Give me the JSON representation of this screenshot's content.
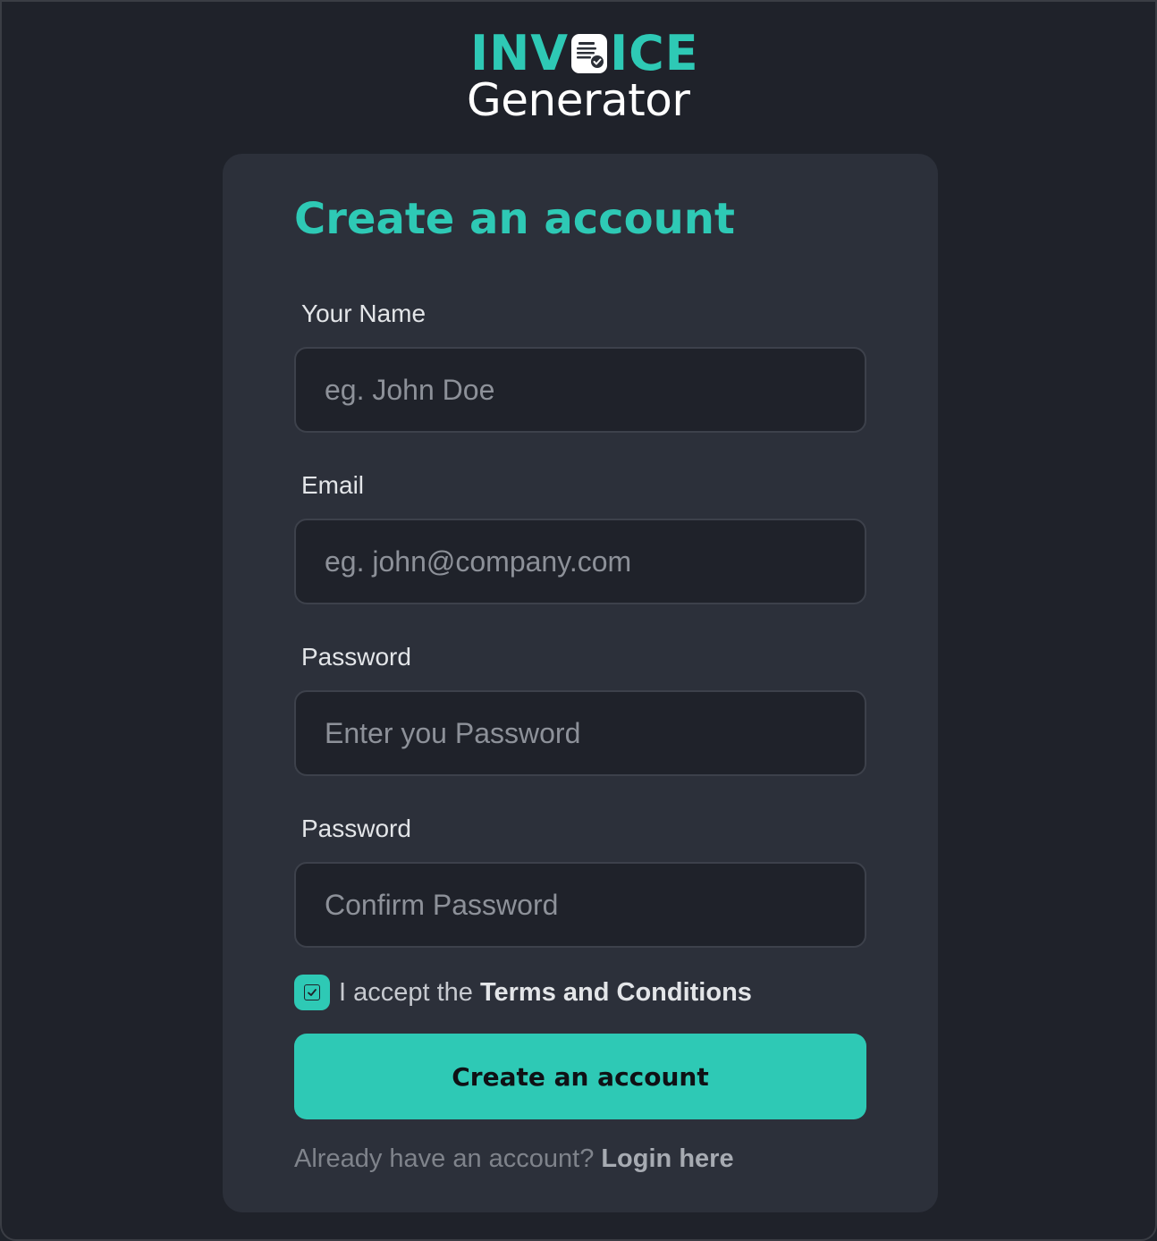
{
  "brand": {
    "logo_top_left": "INV",
    "logo_top_right": "ICE",
    "logo_bottom": "Generator",
    "accent_color": "#2ec9b5",
    "icon": "invoice-document-icon"
  },
  "form": {
    "title": "Create an account",
    "fields": [
      {
        "label": "Your Name",
        "placeholder": "eg. John Doe",
        "value": "",
        "type": "text"
      },
      {
        "label": "Email",
        "placeholder": "eg. john@company.com",
        "value": "",
        "type": "email"
      },
      {
        "label": "Password",
        "placeholder": "Enter you Password",
        "value": "",
        "type": "password"
      },
      {
        "label": "Password",
        "placeholder": "Confirm Password",
        "value": "",
        "type": "password"
      }
    ],
    "terms": {
      "checked": true,
      "prefix": "I accept the",
      "link": "Terms and Conditions"
    },
    "submit_label": "Create an account",
    "footer": {
      "text": "Already have an account?",
      "link": "Login here"
    }
  }
}
